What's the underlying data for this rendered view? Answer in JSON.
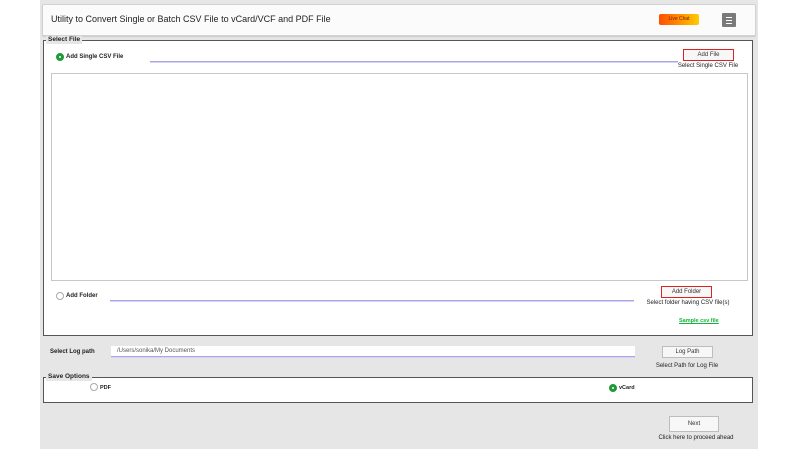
{
  "window": {
    "title": "Utility to Convert Single or Batch CSV File to vCard/VCF and PDF File"
  },
  "header": {
    "live_chat_label": "Live Chat"
  },
  "select_file": {
    "legend": "Select File",
    "single_option_label": "Add Single CSV File",
    "single_path_value": "",
    "add_file_label": "Add File",
    "add_file_caption": "Select Single CSV File",
    "folder_option_label": "Add Folder",
    "folder_path_value": "",
    "add_folder_label": "Add Folder",
    "add_folder_caption": "Select folder having CSV file(s)",
    "sample_link": "Sample csv file",
    "selected_option": "single"
  },
  "log": {
    "label": "Select Log path",
    "path_value": "/Users/sonika/My Documents",
    "button_label": "Log Path",
    "caption": "Select Path for Log File"
  },
  "save_options": {
    "legend": "Save Options",
    "pdf_label": "PDF",
    "vcard_label": "vCard",
    "selected": "vcard"
  },
  "footer": {
    "next_label": "Next",
    "next_caption": "Click here to proceed ahead"
  },
  "colors": {
    "accent_green": "#1f9a3a",
    "link_green": "#11b53a",
    "red_border": "#dd2222",
    "field_underline": "#a9a6e6"
  }
}
